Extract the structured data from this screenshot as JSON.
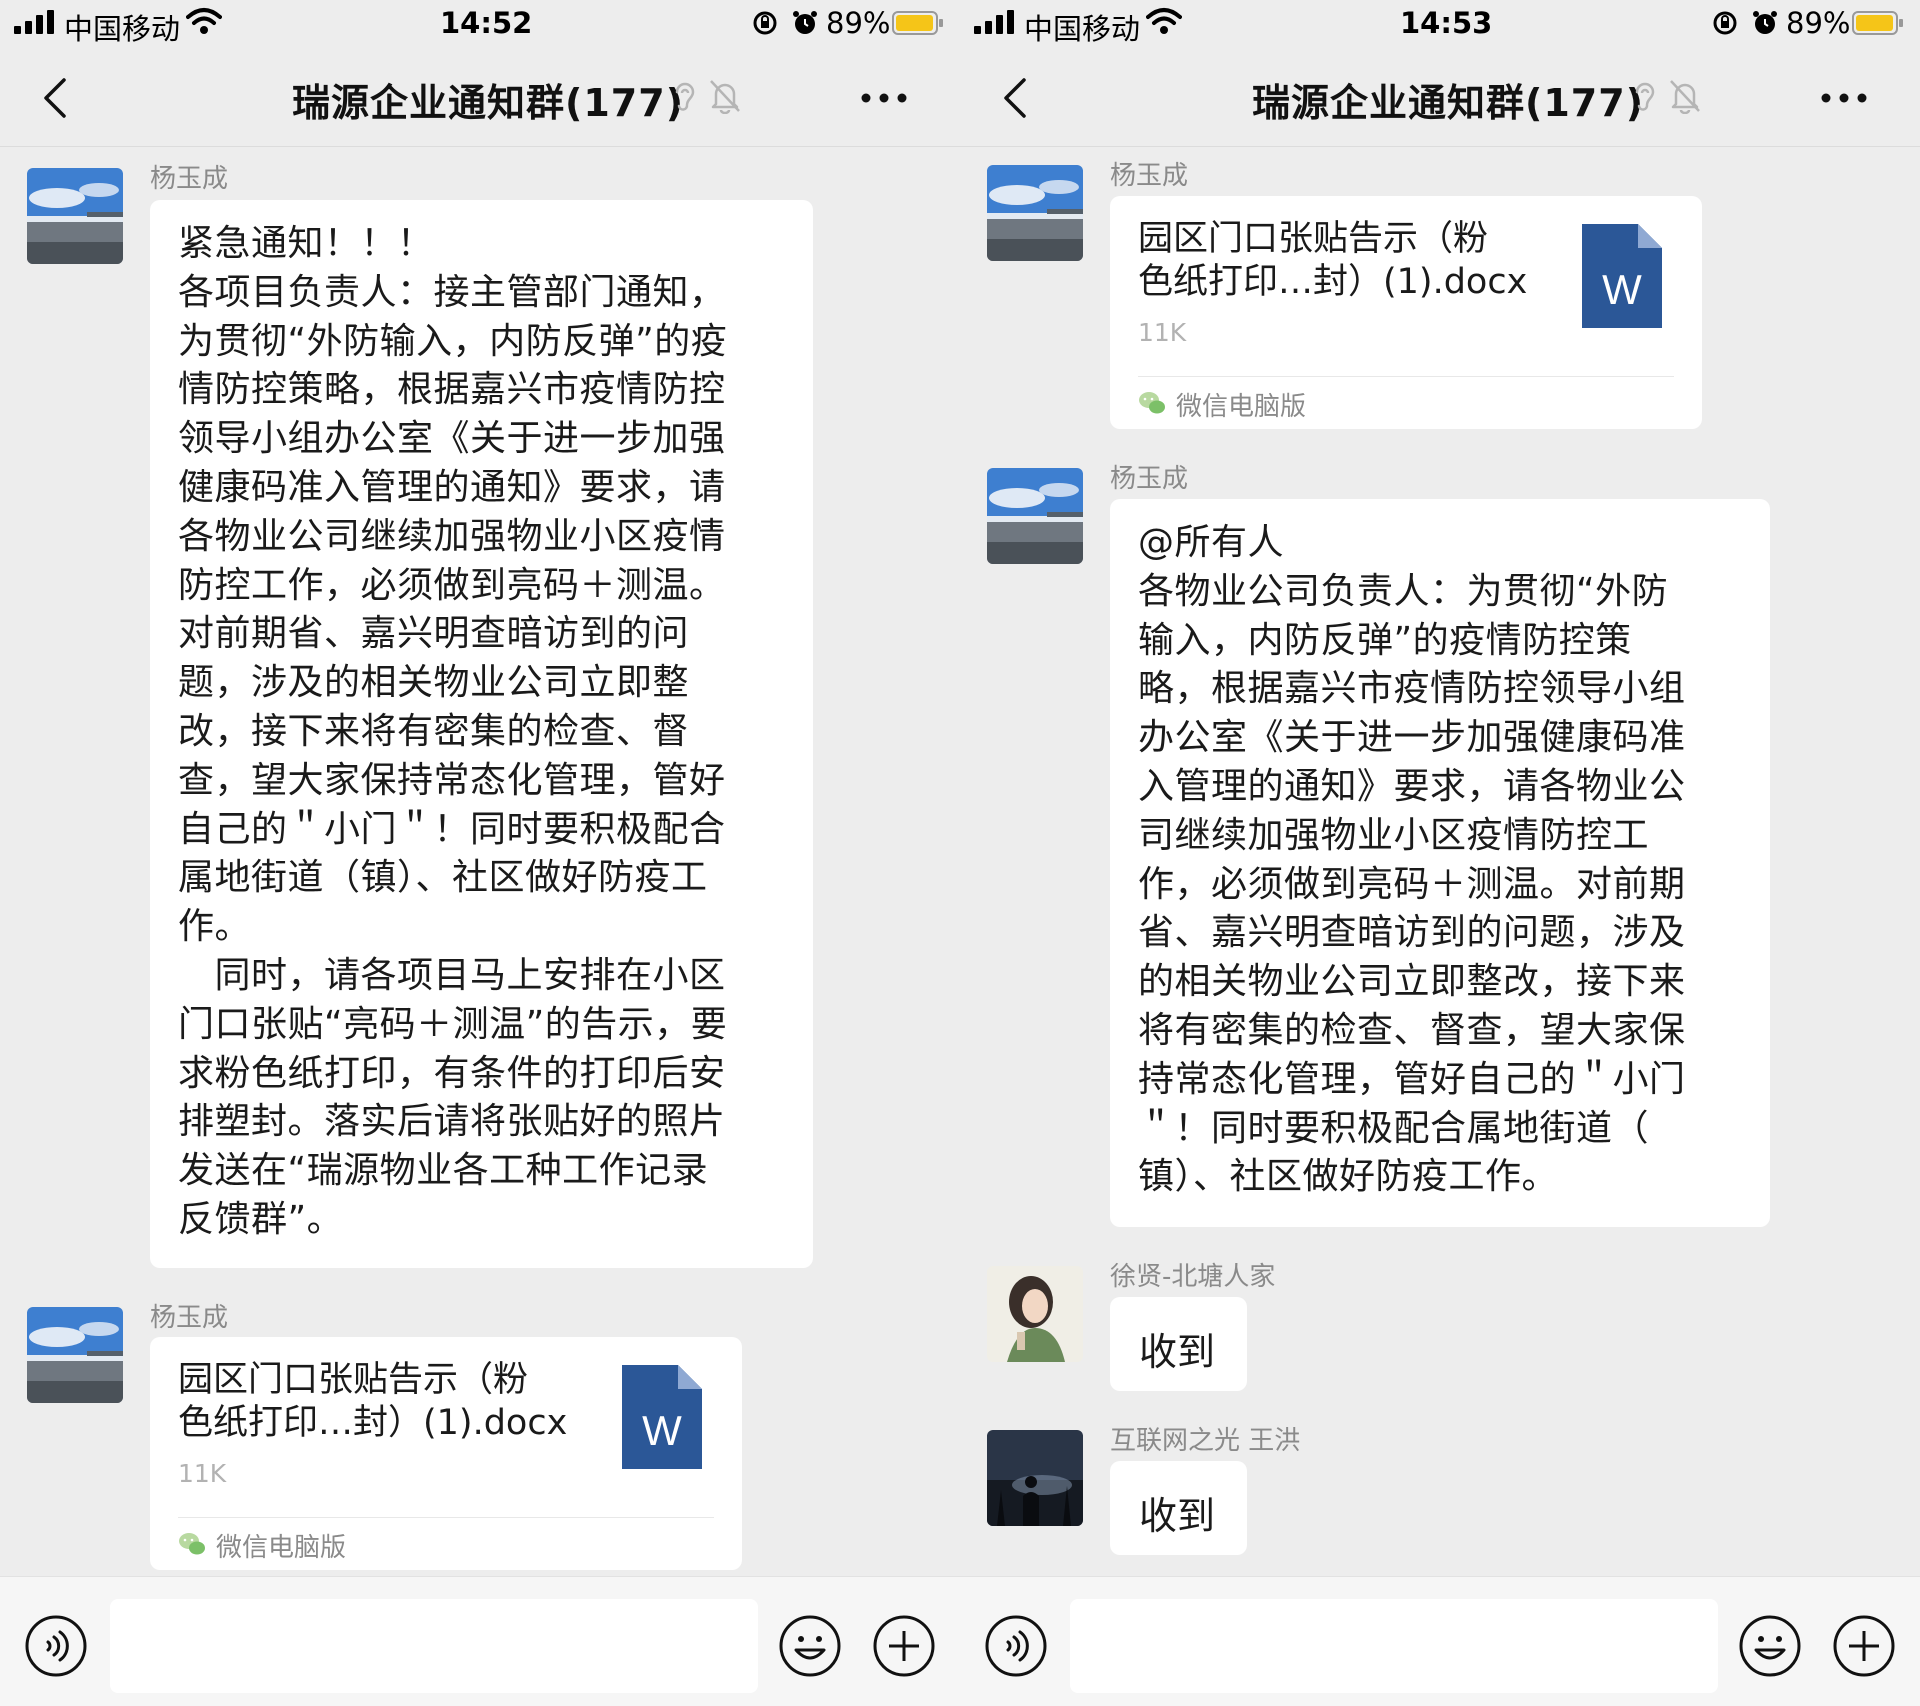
{
  "colors": {
    "background": "#ededed",
    "bubble": "#ffffff",
    "word_icon": "#2b5797",
    "battery": "#f5c518",
    "muted_text": "#8a8a8a"
  },
  "left": {
    "status": {
      "carrier": "中国移动",
      "time": "14:52",
      "battery": "89%"
    },
    "nav": {
      "title": "瑞源企业通知群(177)"
    },
    "messages": [
      {
        "sender": "杨玉成",
        "text": "紧急通知！！！\n各项目负责人：接主管部门通知，\n为贯彻“外防输入，内防反弹”的疫\n情防控策略，根据嘉兴市疫情防控\n领导小组办公室《关于进一步加强\n健康码准入管理的通知》要求，请\n各物业公司继续加强物业小区疫情\n防控工作，必须做到亮码＋测温。\n对前期省、嘉兴明查暗访到的问\n题，涉及的相关物业公司立即整\n改，接下来将有密集的检查、督\n查，望大家保持常态化管理，管好\n自己的＂小门＂！同时要积极配合\n属地街道（镇）、社区做好防疫工\n作。\n　同时，请各项目马上安排在小区\n门口张贴“亮码＋测温”的告示，要\n求粉色纸打印，有条件的打印后安\n排塑封。落实后请将张贴好的照片\n发送在“瑞源物业各工种工作记录\n反馈群”。"
      },
      {
        "sender": "杨玉成",
        "file_name": "园区门口张贴告示（粉\n色纸打印…封）(1).docx",
        "file_size": "11K",
        "source": "微信电脑版"
      }
    ]
  },
  "right": {
    "status": {
      "carrier": "中国移动",
      "time": "14:53",
      "battery": "89%"
    },
    "nav": {
      "title": "瑞源企业通知群(177)"
    },
    "messages": [
      {
        "sender": "杨玉成",
        "file_name": "园区门口张贴告示（粉\n色纸打印…封）(1).docx",
        "file_size": "11K",
        "source": "微信电脑版"
      },
      {
        "sender": "杨玉成",
        "text": "@所有人\n各物业公司负责人：为贯彻“外防\n输入，内防反弹”的疫情防控策\n略，根据嘉兴市疫情防控领导小组\n办公室《关于进一步加强健康码准\n入管理的通知》要求，请各物业公\n司继续加强物业小区疫情防控工\n作，必须做到亮码＋测温。对前期\n省、嘉兴明查暗访到的问题，涉及\n的相关物业公司立即整改，接下来\n将有密集的检查、督查，望大家保\n持常态化管理，管好自己的＂小门\n＂！同时要积极配合属地街道（\n镇）、社区做好防疫工作。"
      },
      {
        "sender": "徐贤-北塘人家",
        "text": "收到"
      },
      {
        "sender": "互联网之光 王洪",
        "text": "收到"
      }
    ]
  }
}
